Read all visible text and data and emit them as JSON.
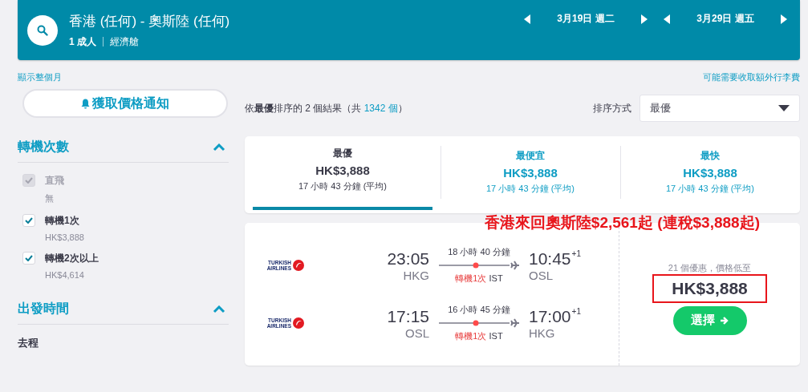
{
  "search_bar": {
    "route": "香港 (任何) - 奧斯陸 (任何)",
    "passengers": "1 成人",
    "cabin": "經濟艙",
    "dates": [
      "3月19日 週二",
      "3月29日 週五"
    ]
  },
  "links": {
    "month": "顯示整個月",
    "baggage": "可能需要收取額外行李費"
  },
  "alert_button": "獲取價格通知",
  "filters": [
    {
      "title": "轉機次數",
      "expanded": true,
      "options": [
        {
          "label": "直飛",
          "price": "無",
          "checked": true,
          "disabled": true
        },
        {
          "label": "轉機1次",
          "price": "HK$3,888",
          "checked": true,
          "disabled": false
        },
        {
          "label": "轉機2次以上",
          "price": "HK$4,614",
          "checked": true,
          "disabled": false
        }
      ]
    },
    {
      "title": "出發時間",
      "expanded": true,
      "subtitle": "去程"
    }
  ],
  "summary": {
    "text": "依**最優**排序的 2 個結果（共",
    "count": "1342 個",
    "close": "）"
  },
  "sort": {
    "label": "排序方式",
    "value": "最優"
  },
  "tabs": [
    {
      "title": "最優",
      "price": "HK$3,888",
      "duration": "17 小時 43 分鐘 (平均)",
      "selected": true
    },
    {
      "title": "最便宜",
      "price": "HK$3,888",
      "duration": "17 小時 43 分鐘 (平均)",
      "selected": false
    },
    {
      "title": "最快",
      "price": "HK$3,888",
      "duration": "17 小時 43 分鐘 (平均)",
      "selected": false
    }
  ],
  "annotation": "香港來回奧斯陸$2,561起 (連稅$3,888起)",
  "result": {
    "legs": [
      {
        "airline": "TURKISH AIRLINES",
        "depart": "23:05",
        "from": "HKG",
        "duration": "18 小時 40 分鐘",
        "arrive": "10:45",
        "day_offset": "+1",
        "to": "OSL",
        "stops": "轉機1次",
        "via": "IST"
      },
      {
        "airline": "TURKISH AIRLINES",
        "depart": "17:15",
        "from": "OSL",
        "duration": "16 小時 45 分鐘",
        "arrive": "17:00",
        "day_offset": "+1",
        "to": "HKG",
        "stops": "轉機1次",
        "via": "IST"
      }
    ],
    "deals": "21 個優惠，價格低至",
    "price": "HK$3,888",
    "highlighted": true,
    "button": "選擇"
  }
}
